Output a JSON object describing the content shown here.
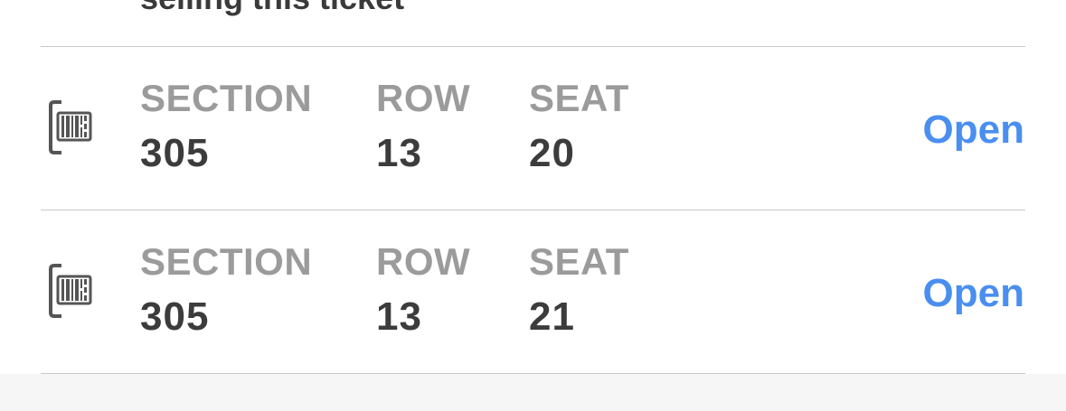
{
  "header": {
    "partial_text": "selling this ticket"
  },
  "tickets": [
    {
      "section_label": "SECTION",
      "section": "305",
      "row_label": "ROW",
      "row": "13",
      "seat_label": "SEAT",
      "seat": "20",
      "action_label": "Open",
      "icon": "ticket-barcode-icon"
    },
    {
      "section_label": "SECTION",
      "section": "305",
      "row_label": "ROW",
      "row": "13",
      "seat_label": "SEAT",
      "seat": "21",
      "action_label": "Open",
      "icon": "ticket-barcode-icon"
    }
  ],
  "colors": {
    "accent": "#4a8ef0",
    "label": "#9b9b9b",
    "value": "#3c3c3c",
    "divider": "#c8c8c8",
    "footer_background": "#f6f6f6"
  }
}
